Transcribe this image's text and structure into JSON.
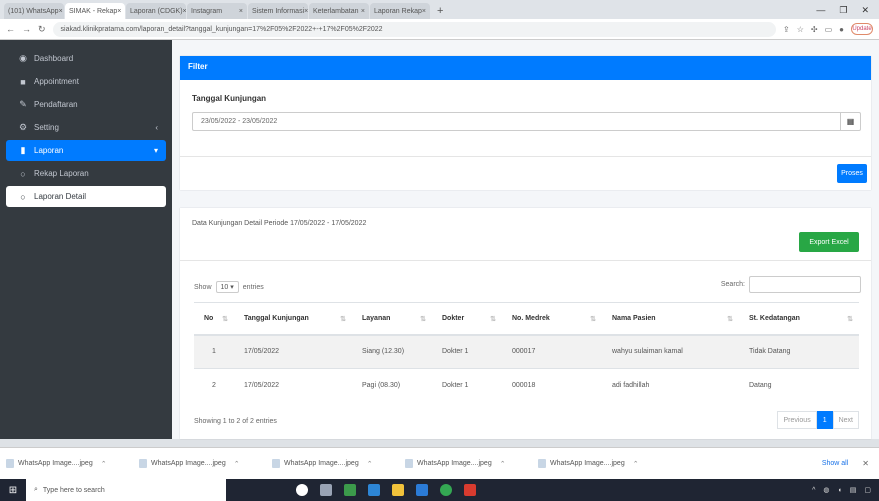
{
  "browser": {
    "tabs": [
      "(101) WhatsApp",
      "SIMAK - Rekap",
      "Laporan (CDGK)",
      "Instagram",
      "Sistem Informasi",
      "Keterlambatan",
      "Laporan Rekap"
    ],
    "new_tab": "+",
    "url": "siakad.klinikpratama.com/laporan_detail?tanggal_kunjungan=17%2F05%2F2022+-+17%2F05%2F2022",
    "profile": "Update"
  },
  "sidebar": {
    "items": [
      {
        "label": "Dashboard",
        "icon": "dashboard-icon"
      },
      {
        "label": "Appointment",
        "icon": "book-icon"
      },
      {
        "label": "Pendaftaran",
        "icon": "edit-icon"
      },
      {
        "label": "Setting",
        "icon": "gears-icon"
      },
      {
        "label": "Laporan",
        "icon": "file-icon"
      },
      {
        "label": "Rekap Laporan",
        "icon": "circle-icon"
      },
      {
        "label": "Laporan Detail",
        "icon": "circle-icon"
      }
    ]
  },
  "filter": {
    "title": "Filter",
    "label": "Tanggal Kunjungan",
    "date_value": "23/05/2022 - 23/05/2022",
    "submit": "Proses"
  },
  "report": {
    "title": "Data Kunjungan Detail Periode 17/05/2022 - 17/05/2022",
    "export": "Export Excel",
    "show_prefix": "Show",
    "show_value": "10",
    "show_suffix": "entries",
    "search_label": "Search:",
    "columns": [
      "No",
      "Tanggal Kunjungan",
      "Layanan",
      "Dokter",
      "No. Medrek",
      "Nama Pasien",
      "St. Kedatangan"
    ],
    "rows": [
      {
        "no": "1",
        "tanggal": "17/05/2022",
        "layanan": "Siang (12.30)",
        "dokter": "Dokter 1",
        "medrek": "000017",
        "nama": "wahyu sulaiman kamal",
        "status": "Tidak Datang"
      },
      {
        "no": "2",
        "tanggal": "17/05/2022",
        "layanan": "Pagi (08.30)",
        "dokter": "Dokter 1",
        "medrek": "000018",
        "nama": "adi fadhillah",
        "status": "Datang"
      }
    ],
    "info": "Showing 1 to 2 of 2 entries",
    "pager": {
      "prev": "Previous",
      "current": "1",
      "next": "Next"
    }
  },
  "downloads": {
    "items": [
      "WhatsApp Image....jpeg",
      "WhatsApp Image....jpeg",
      "WhatsApp Image....jpeg",
      "WhatsApp Image....jpeg",
      "WhatsApp Image....jpeg"
    ],
    "show_all": "Show all"
  },
  "taskbar": {
    "search_placeholder": "Type here to search"
  }
}
